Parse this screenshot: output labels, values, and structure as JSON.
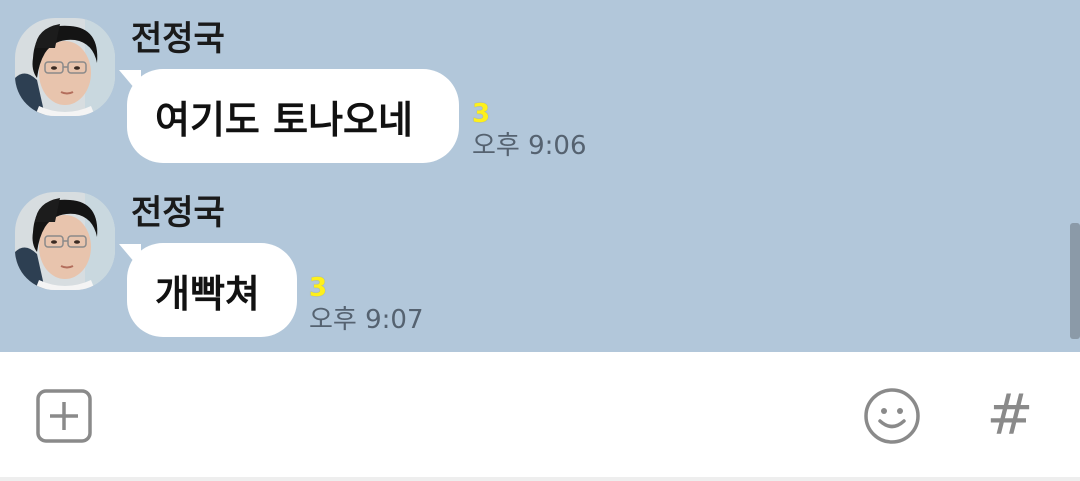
{
  "messages": [
    {
      "sender": "전정국",
      "text": "여기도 토나오네",
      "unread_count": "3",
      "time": "오후 9:06"
    },
    {
      "sender": "전정국",
      "text": "개빡쳐",
      "unread_count": "3",
      "time": "오후 9:07"
    }
  ],
  "input_bar": {
    "add_icon": "plus-square-icon",
    "emoji_icon": "smiley-icon",
    "hashtag_label": "#"
  },
  "colors": {
    "chat_background": "#b2c7da",
    "bubble": "#ffffff",
    "unread": "#fef01b",
    "time": "#556270"
  }
}
